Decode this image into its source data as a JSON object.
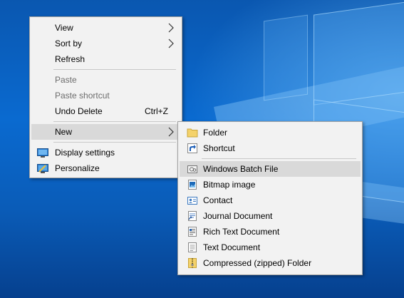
{
  "context_menu": {
    "items": [
      {
        "label": "View"
      },
      {
        "label": "Sort by"
      },
      {
        "label": "Refresh"
      },
      {
        "label": "Paste"
      },
      {
        "label": "Paste shortcut"
      },
      {
        "label": "Undo Delete",
        "shortcut": "Ctrl+Z"
      },
      {
        "label": "New"
      },
      {
        "label": "Display settings",
        "icon": "display-settings-icon"
      },
      {
        "label": "Personalize",
        "icon": "personalize-icon"
      }
    ]
  },
  "new_submenu": {
    "items": [
      {
        "label": "Folder",
        "icon": "folder-icon"
      },
      {
        "label": "Shortcut",
        "icon": "shortcut-icon"
      },
      {
        "label": "Windows Batch File",
        "icon": "batch-file-icon"
      },
      {
        "label": "Bitmap image",
        "icon": "bitmap-icon"
      },
      {
        "label": "Contact",
        "icon": "contact-icon"
      },
      {
        "label": "Journal Document",
        "icon": "journal-icon"
      },
      {
        "label": "Rich Text Document",
        "icon": "rich-text-icon"
      },
      {
        "label": "Text Document",
        "icon": "text-document-icon"
      },
      {
        "label": "Compressed (zipped) Folder",
        "icon": "zip-folder-icon"
      }
    ]
  }
}
